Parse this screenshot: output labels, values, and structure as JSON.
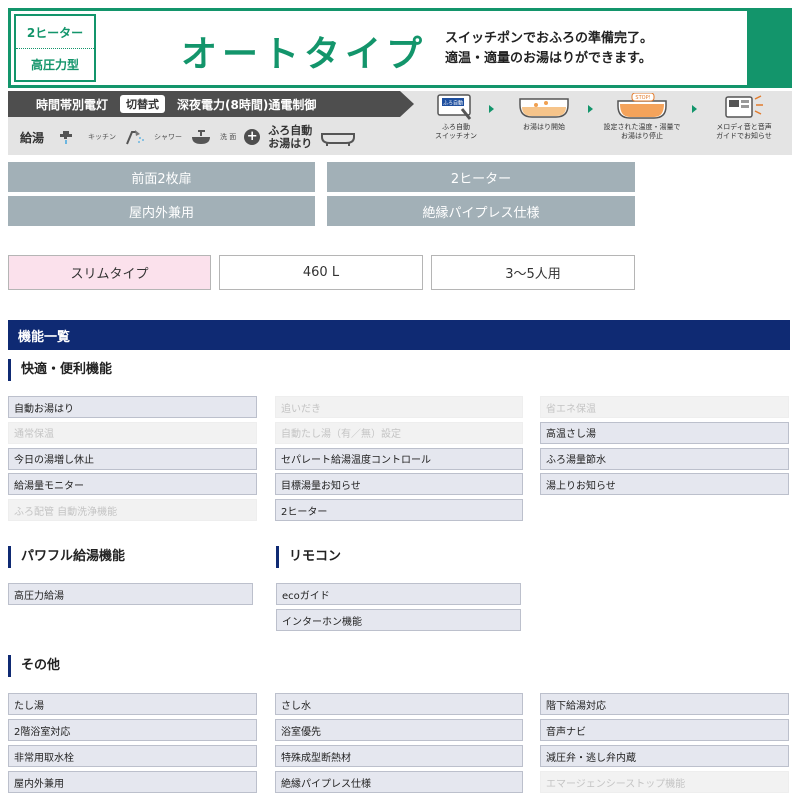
{
  "banner": {
    "tags": [
      "2ヒーター",
      "高圧力型"
    ],
    "title": "オートタイプ",
    "tagline_1": "スイッチポンでおふろの準備完了。",
    "tagline_2": "適温・適量のお湯はりができます。"
  },
  "spec": {
    "left_text": "時間帯別電灯",
    "switch_label": "切替式",
    "right_text": "深夜電力(8時間)通電制御",
    "supply_label": "給湯",
    "kitchen": "キッチン",
    "shower": "シャワー",
    "wash": "洗 面",
    "auto_fill_1": "ふろ自動",
    "auto_fill_2": "お湯はり",
    "remote_button": "ふろ自動",
    "steps": [
      {
        "label_1": "ふろ自動",
        "label_2": "スイッチオン"
      },
      {
        "label_1": "お湯はり開始",
        "label_2": ""
      },
      {
        "label_1": "設定された温度・湯量で",
        "label_2": "お湯はり停止"
      },
      {
        "label_1": "メロディ音と音声",
        "label_2": "ガイドでお知らせ"
      }
    ],
    "stop_label": "STOP!"
  },
  "attributes": [
    "前面2枚扉",
    "2ヒーター",
    "屋内外兼用",
    "絶縁パイプレス仕様"
  ],
  "options": [
    "スリムタイプ",
    "460 L",
    "3〜5人用"
  ],
  "features": {
    "header": "機能一覧",
    "comfort": {
      "title": "快適・便利機能",
      "items": [
        {
          "label": "自動お湯はり",
          "on": true
        },
        {
          "label": "追いだき",
          "on": false
        },
        {
          "label": "省エネ保温",
          "on": false
        },
        {
          "label": "通常保温",
          "on": false
        },
        {
          "label": "自動たし湯（有／無）設定",
          "on": false
        },
        {
          "label": "高温さし湯",
          "on": true
        },
        {
          "label": "今日の湯増し休止",
          "on": true
        },
        {
          "label": "セパレート給湯温度コントロール",
          "on": true
        },
        {
          "label": "ふろ湯量節水",
          "on": true
        },
        {
          "label": "給湯量モニター",
          "on": true
        },
        {
          "label": "目標湯量お知らせ",
          "on": true
        },
        {
          "label": "湯上りお知らせ",
          "on": true
        },
        {
          "label": "ふろ配管 自動洗浄機能",
          "on": false
        },
        {
          "label": "2ヒーター",
          "on": true
        }
      ]
    },
    "power": {
      "title": "パワフル給湯機能",
      "items": [
        {
          "label": "高圧力給湯",
          "on": true
        }
      ]
    },
    "remote": {
      "title": "リモコン",
      "items": [
        {
          "label": "ecoガイド",
          "on": true
        },
        {
          "label": "インターホン機能",
          "on": true
        }
      ]
    },
    "other": {
      "title": "その他",
      "items": [
        {
          "label": "たし湯",
          "on": true
        },
        {
          "label": "さし水",
          "on": true
        },
        {
          "label": "階下給湯対応",
          "on": true
        },
        {
          "label": "2階浴室対応",
          "on": true
        },
        {
          "label": "浴室優先",
          "on": true
        },
        {
          "label": "音声ナビ",
          "on": true
        },
        {
          "label": "非常用取水栓",
          "on": true
        },
        {
          "label": "特殊成型断熱材",
          "on": true
        },
        {
          "label": "減圧弁・逃し弁内蔵",
          "on": true
        },
        {
          "label": "屋内外兼用",
          "on": true
        },
        {
          "label": "絶縁パイプレス仕様",
          "on": true
        },
        {
          "label": "エマージェンシーストップ機能",
          "on": false
        }
      ]
    }
  },
  "colors": {
    "brand_green": "#13956b",
    "navy": "#0f2a73",
    "attribute_grey": "#a2b0b7",
    "pink": "#fbe1ec"
  }
}
